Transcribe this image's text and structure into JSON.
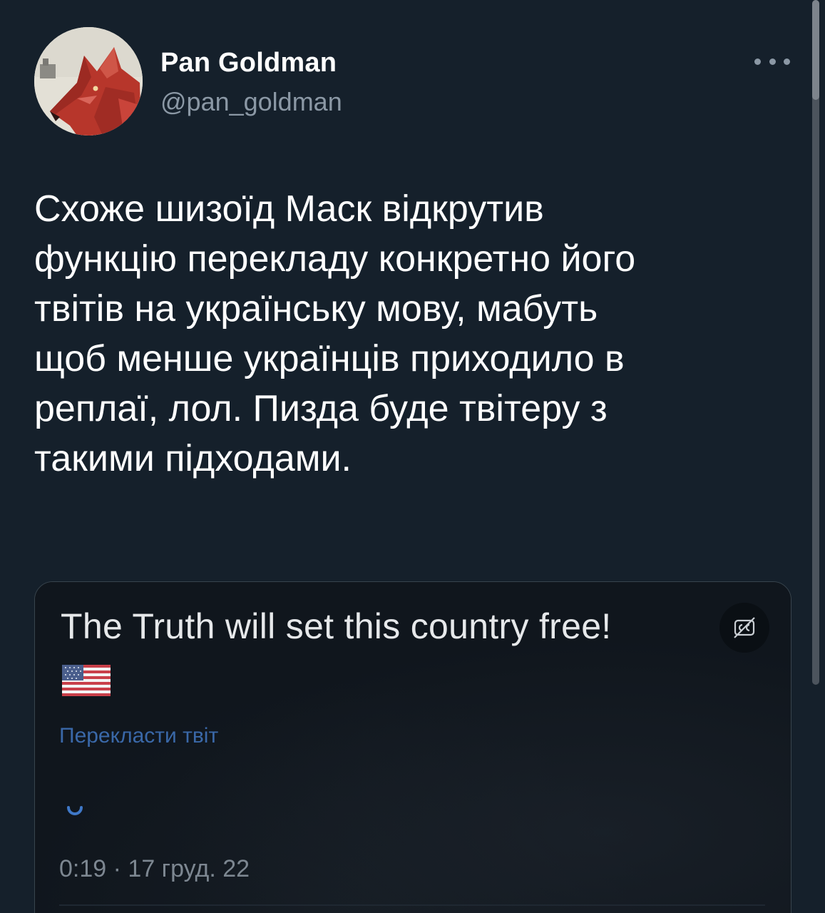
{
  "tweet": {
    "author_name": "Pan Goldman",
    "author_handle": "@pan_goldman",
    "more_icon": "more-horizontal-icon",
    "text": "Схоже шизоїд Маск відкрутив\nфункцію перекладу конкретно його\nтвітів на українську мову, мабуть\nщоб менше українців приходило в\nреплаї, лол. Пизда буде твітеру з\nтакими підходами."
  },
  "quote": {
    "text": "The Truth will set this country free!",
    "flag_icon": "us-flag-icon",
    "translate_link": "Перекласти твіт",
    "loading_icon": "loading-spinner-icon",
    "time": "0:19",
    "separator": "·",
    "date": "17 груд. 22",
    "caption_icon": "captions-off-icon"
  },
  "colors": {
    "background": "#15202b",
    "text_primary": "#ffffff",
    "text_secondary": "#8b98a5",
    "link": "#3a68a8",
    "border": "#38444d"
  }
}
